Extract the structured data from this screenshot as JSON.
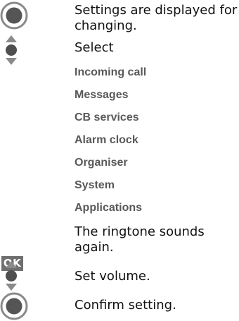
{
  "steps": [
    {
      "icon": "center-key-icon",
      "text": "Settings are displayed for changing."
    },
    {
      "icon": "navigation-key-icon",
      "text": "Select"
    },
    {
      "icon": "ok-key",
      "key_label": "OK",
      "text": "The ringtone sounds again."
    },
    {
      "icon": "navigation-key-icon",
      "text": "Set volume."
    },
    {
      "icon": "center-key-icon",
      "text": "Confirm setting."
    }
  ],
  "menu_items": [
    "Incoming call",
    "Messages",
    "CB services",
    "Alarm clock",
    "Organiser",
    "System",
    "Applications"
  ]
}
